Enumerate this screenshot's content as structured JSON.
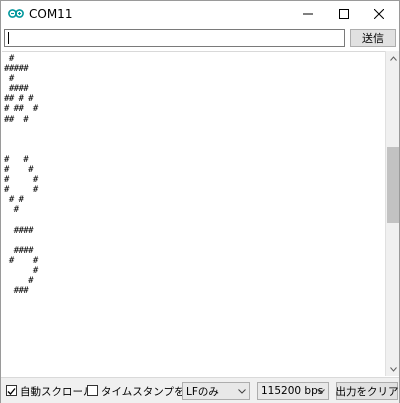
{
  "window": {
    "title": "COM11",
    "app_icon": "arduino-infinity-icon",
    "controls": [
      "minimize-icon",
      "maximize-icon",
      "close-icon"
    ]
  },
  "input": {
    "value": "",
    "send_label": "送信"
  },
  "output": {
    "lines": [
      " #",
      "#####",
      " #",
      " ####",
      "## # #",
      "# ##  #",
      "##  #",
      "",
      "",
      "",
      "#   #",
      "#    #",
      "#     #",
      "#     #",
      " # #",
      "  #",
      "",
      "  ####",
      "",
      "  ####",
      " #    #",
      "      #",
      "     #",
      "  ###"
    ]
  },
  "bottombar": {
    "autoscroll_label": "自動スクロール",
    "autoscroll_checked": true,
    "timestamp_label": "タイムスタンプを表示",
    "timestamp_checked": false,
    "line_ending": "LFのみ",
    "baud_rate": "115200 bps",
    "clear_label": "出力をクリア"
  }
}
